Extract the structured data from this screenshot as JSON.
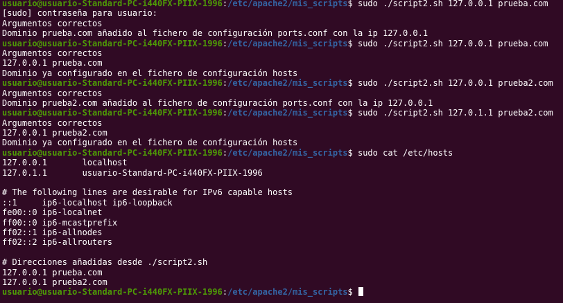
{
  "colors": {
    "background": "#300a24",
    "prompt_user": "#4e9a06",
    "prompt_path": "#3465a4",
    "text": "#ffffff"
  },
  "prompt": {
    "user_host": "usuario@usuario-Standard-PC-i440FX-PIIX-1996",
    "path": "/etc/apache2/mis_scripts"
  },
  "lines": [
    {
      "type": "prompt",
      "command": "sudo ./script2.sh 127.0.0.1 prueba.com"
    },
    {
      "type": "output",
      "text": "[sudo] contraseña para usuario:"
    },
    {
      "type": "output",
      "text": "Argumentos correctos"
    },
    {
      "type": "output",
      "text": "Dominio prueba.com añadido al fichero de configuración ports.conf con la ip 127.0.0.1"
    },
    {
      "type": "prompt",
      "command": "sudo ./script2.sh 127.0.0.1 prueba.com"
    },
    {
      "type": "output",
      "text": "Argumentos correctos"
    },
    {
      "type": "output",
      "text": "127.0.0.1 prueba.com"
    },
    {
      "type": "output",
      "text": "Dominio ya configurado en el fichero de configuración hosts"
    },
    {
      "type": "prompt",
      "command": "sudo ./script2.sh 127.0.0.1 prueba2.com"
    },
    {
      "type": "output",
      "text": "Argumentos correctos"
    },
    {
      "type": "output",
      "text": "Dominio prueba2.com añadido al fichero de configuración ports.conf con la ip 127.0.0.1"
    },
    {
      "type": "prompt",
      "command": "sudo ./script2.sh 127.0.1.1 prueba2.com"
    },
    {
      "type": "output",
      "text": "Argumentos correctos"
    },
    {
      "type": "output",
      "text": "127.0.0.1 prueba2.com"
    },
    {
      "type": "output",
      "text": "Dominio ya configurado en el fichero de configuración hosts"
    },
    {
      "type": "prompt",
      "command": "sudo cat /etc/hosts"
    },
    {
      "type": "output",
      "text": "127.0.0.1       localhost"
    },
    {
      "type": "output",
      "text": "127.0.1.1       usuario-Standard-PC-i440FX-PIIX-1996"
    },
    {
      "type": "output",
      "text": ""
    },
    {
      "type": "output",
      "text": "# The following lines are desirable for IPv6 capable hosts"
    },
    {
      "type": "output",
      "text": "::1     ip6-localhost ip6-loopback"
    },
    {
      "type": "output",
      "text": "fe00::0 ip6-localnet"
    },
    {
      "type": "output",
      "text": "ff00::0 ip6-mcastprefix"
    },
    {
      "type": "output",
      "text": "ff02::1 ip6-allnodes"
    },
    {
      "type": "output",
      "text": "ff02::2 ip6-allrouters"
    },
    {
      "type": "output",
      "text": ""
    },
    {
      "type": "output",
      "text": "# Direcciones añadidas desde ./script2.sh"
    },
    {
      "type": "output",
      "text": "127.0.0.1 prueba.com"
    },
    {
      "type": "output",
      "text": "127.0.0.1 prueba2.com"
    },
    {
      "type": "prompt",
      "command": "",
      "cursor": true
    }
  ]
}
